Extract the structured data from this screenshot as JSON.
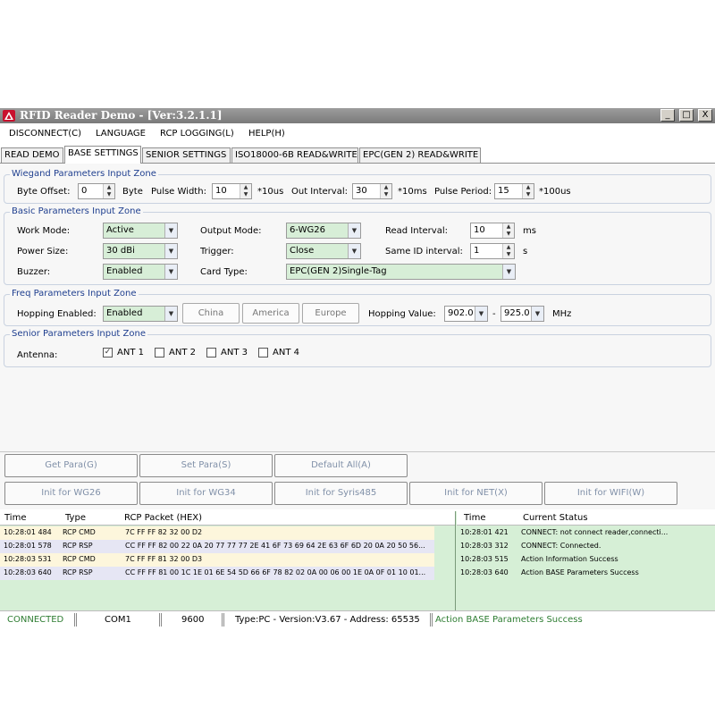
{
  "window": {
    "title": "RFID Reader Demo - [Ver:3.2.1.1]",
    "buttons": [
      "_",
      "□",
      "X"
    ]
  },
  "menu": [
    "DISCONNECT(C)",
    "LANGUAGE",
    "RCP LOGGING(L)",
    "HELP(H)"
  ],
  "tabs": [
    "READ DEMO",
    "BASE SETTINGS",
    "SENIOR SETTINGS",
    "ISO18000-6B READ&WRITE",
    "EPC(GEN 2) READ&WRITE"
  ],
  "wiegand": {
    "title": "Wiegand Parameters Input Zone",
    "byte_offset_label": "Byte Offset:",
    "byte_offset": "0",
    "byte_offset_unit": "Byte",
    "pulse_width_label": "Pulse Width:",
    "pulse_width": "10",
    "pulse_width_unit": "*10us",
    "out_interval_label": "Out Interval:",
    "out_interval": "30",
    "out_interval_unit": "*10ms",
    "pulse_period_label": "Pulse Period:",
    "pulse_period": "15",
    "pulse_period_unit": "*100us"
  },
  "basic": {
    "title": "Basic Parameters Input Zone",
    "work_mode_label": "Work Mode:",
    "work_mode": "Active",
    "output_mode_label": "Output Mode:",
    "output_mode": "6-WG26",
    "read_interval_label": "Read Interval:",
    "read_interval": "10",
    "read_interval_unit": "ms",
    "power_size_label": "Power Size:",
    "power_size": "30 dBi",
    "trigger_label": "Trigger:",
    "trigger": "Close",
    "same_id_label": "Same ID interval:",
    "same_id": "1",
    "same_id_unit": "s",
    "buzzer_label": "Buzzer:",
    "buzzer": "Enabled",
    "card_type_label": "Card Type:",
    "card_type": "EPC(GEN 2)Single-Tag"
  },
  "freq": {
    "title": "Freq Parameters Input Zone",
    "hopping_enabled_label": "Hopping Enabled:",
    "hopping_enabled": "Enabled",
    "china": "China",
    "america": "America",
    "europe": "Europe",
    "hopping_value_label": "Hopping Value:",
    "hop_from": "902.0",
    "dash": "-",
    "hop_to": "925.0",
    "unit": "MHz"
  },
  "senior": {
    "title": "Senior Parameters Input Zone",
    "antenna_label": "Antenna:",
    "antennas": [
      {
        "label": "ANT 1",
        "checked": true,
        "mark": "✓"
      },
      {
        "label": "ANT 2",
        "checked": false,
        "mark": ""
      },
      {
        "label": "ANT 3",
        "checked": false,
        "mark": ""
      },
      {
        "label": "ANT 4",
        "checked": false,
        "mark": ""
      }
    ]
  },
  "actions": {
    "row1": [
      "Get Para(G)",
      "Set Para(S)",
      "Default All(A)"
    ],
    "row2": [
      "Init for WG26",
      "Init for WG34",
      "Init for Syris485",
      "Init for NET(X)",
      "Init for WIFI(W)"
    ]
  },
  "packet_log": {
    "headers": [
      "Time",
      "Type",
      "RCP Packet (HEX)"
    ],
    "rows": [
      {
        "time": "10:28:01 484",
        "type": "RCP CMD",
        "packet": "7C FF FF 82 32 00 D2"
      },
      {
        "time": "10:28:01 578",
        "type": "RCP RSP",
        "packet": "CC FF FF 82 00 22 0A 20 77 77 77 2E 41 6F 73 69 64 2E 63 6F 6D 20 0A 20 50 56..."
      },
      {
        "time": "10:28:03 531",
        "type": "RCP CMD",
        "packet": "7C FF FF 81 32 00 D3"
      },
      {
        "time": "10:28:03 640",
        "type": "RCP RSP",
        "packet": "CC FF FF 81 00 1C 1E 01 6E 54 5D 66 6F 78 82 02 0A 00 06 00 1E 0A 0F 01 10 01..."
      }
    ]
  },
  "status_log": {
    "headers": [
      "Time",
      "Current Status"
    ],
    "rows": [
      {
        "time": "10:28:01 421",
        "status": "CONNECT: not connect reader,connecti..."
      },
      {
        "time": "10:28:03 312",
        "status": "CONNECT: Connected."
      },
      {
        "time": "10:28:03 515",
        "status": "Action Information Success"
      },
      {
        "time": "10:28:03 640",
        "status": "Action BASE Parameters Success"
      }
    ]
  },
  "statusbar": {
    "connection": "CONNECTED",
    "port": "COM1",
    "baud": "9600",
    "info": "Type:PC - Version:V3.67 - Address: 65535",
    "message": "Action BASE Parameters Success"
  },
  "colors": {
    "combo_bg": "#d7eed7",
    "log_bg": "#d6efd6",
    "cmd_row": "#fdf6dc",
    "rsp_row": "#e6e6f4",
    "status_green": "#2e7d32",
    "group_title": "#1f3f8f"
  }
}
